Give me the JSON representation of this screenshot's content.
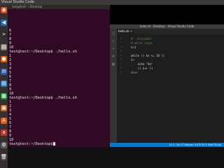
{
  "topbar": {
    "title": "Visual Studio Code",
    "tray": ""
  },
  "launcher": {
    "items": [
      {
        "icon": "ubuntu-dash-icon",
        "glyph": "◉",
        "color": "#dd4814"
      },
      {
        "icon": "vscode-icon",
        "glyph": "◀",
        "color": "#1f6fb5"
      },
      {
        "icon": "terminal-icon",
        "glyph": ">",
        "color": "#2b2b2b"
      },
      {
        "icon": "files-icon",
        "glyph": "▤",
        "color": "#8a7f6e"
      },
      {
        "icon": "firefox-icon",
        "glyph": "●",
        "color": "#e66000"
      },
      {
        "icon": "thunderbird-icon",
        "glyph": "✉",
        "color": "#2e5fa8"
      },
      {
        "icon": "libreoffice-writer-icon",
        "glyph": "▤",
        "color": "#2a7ab8"
      },
      {
        "icon": "libreoffice-calc-icon",
        "glyph": "▦",
        "color": "#1e9a3a"
      },
      {
        "icon": "libreoffice-impress-icon",
        "glyph": "▣",
        "color": "#d4661c"
      },
      {
        "icon": "software-center-icon",
        "glyph": "A",
        "color": "#e05c1a"
      },
      {
        "icon": "amazon-icon",
        "glyph": "a",
        "color": "#c9302c"
      },
      {
        "icon": "settings-icon",
        "glyph": "⚙",
        "color": "#5a5a5a"
      },
      {
        "icon": "trash-icon",
        "glyph": "🗑",
        "color": "#4a4a4a"
      }
    ]
  },
  "terminal": {
    "title": "test@test: ~/Desktop",
    "lines": [
      "6",
      "7",
      "8",
      "9",
      "10",
      "test@test:~/Desktop$ ./hello.sh",
      "",
      "",
      "",
      "",
      "",
      "",
      "",
      "",
      "",
      "",
      "",
      "",
      "",
      "",
      "test@test:~/Desktop$ ./hello.sh",
      "",
      "",
      "",
      "",
      "",
      "",
      "",
      "",
      "",
      "test@test:~/Desktop$ "
    ],
    "numbers_a": [
      "1",
      "2",
      "3",
      "4",
      "5",
      "6",
      "7",
      "8",
      "9",
      "10"
    ],
    "numbers_b": [
      "1",
      "2",
      "3",
      "4",
      "5",
      "6",
      "7",
      "8",
      "9",
      "10"
    ],
    "prompt1": "test@test:~/Desktop$ ./hello.sh",
    "prompt2": "test@test:~/Desktop$ ./hello.sh",
    "prompt3": "test@test:~/Desktop$"
  },
  "vscode": {
    "window_title": "hello.sh - Desktop - Visual Studio Code",
    "tab_label": "hello.sh",
    "code_lines": [
      {
        "n": "1",
        "text": "#! /bin/bash",
        "cls": "c-com"
      },
      {
        "n": "2",
        "text": "# while loops",
        "cls": "c-com"
      },
      {
        "n": "3",
        "text": "n=1",
        "cls": ""
      },
      {
        "n": "4",
        "text": "",
        "cls": ""
      },
      {
        "n": "5",
        "text": "while (( $n <= 10 ))",
        "cls": ""
      },
      {
        "n": "6",
        "text": "do",
        "cls": "c-kw"
      },
      {
        "n": "7",
        "text": "    echo \"$n\"",
        "cls": ""
      },
      {
        "n": "8",
        "text": "    (( n++ ))",
        "cls": ""
      },
      {
        "n": "9",
        "text": "done",
        "cls": "c-kw"
      }
    ],
    "status": "Ln 5, Col 17   Spaces: 4   UTF-8   LF   Shell Script"
  }
}
